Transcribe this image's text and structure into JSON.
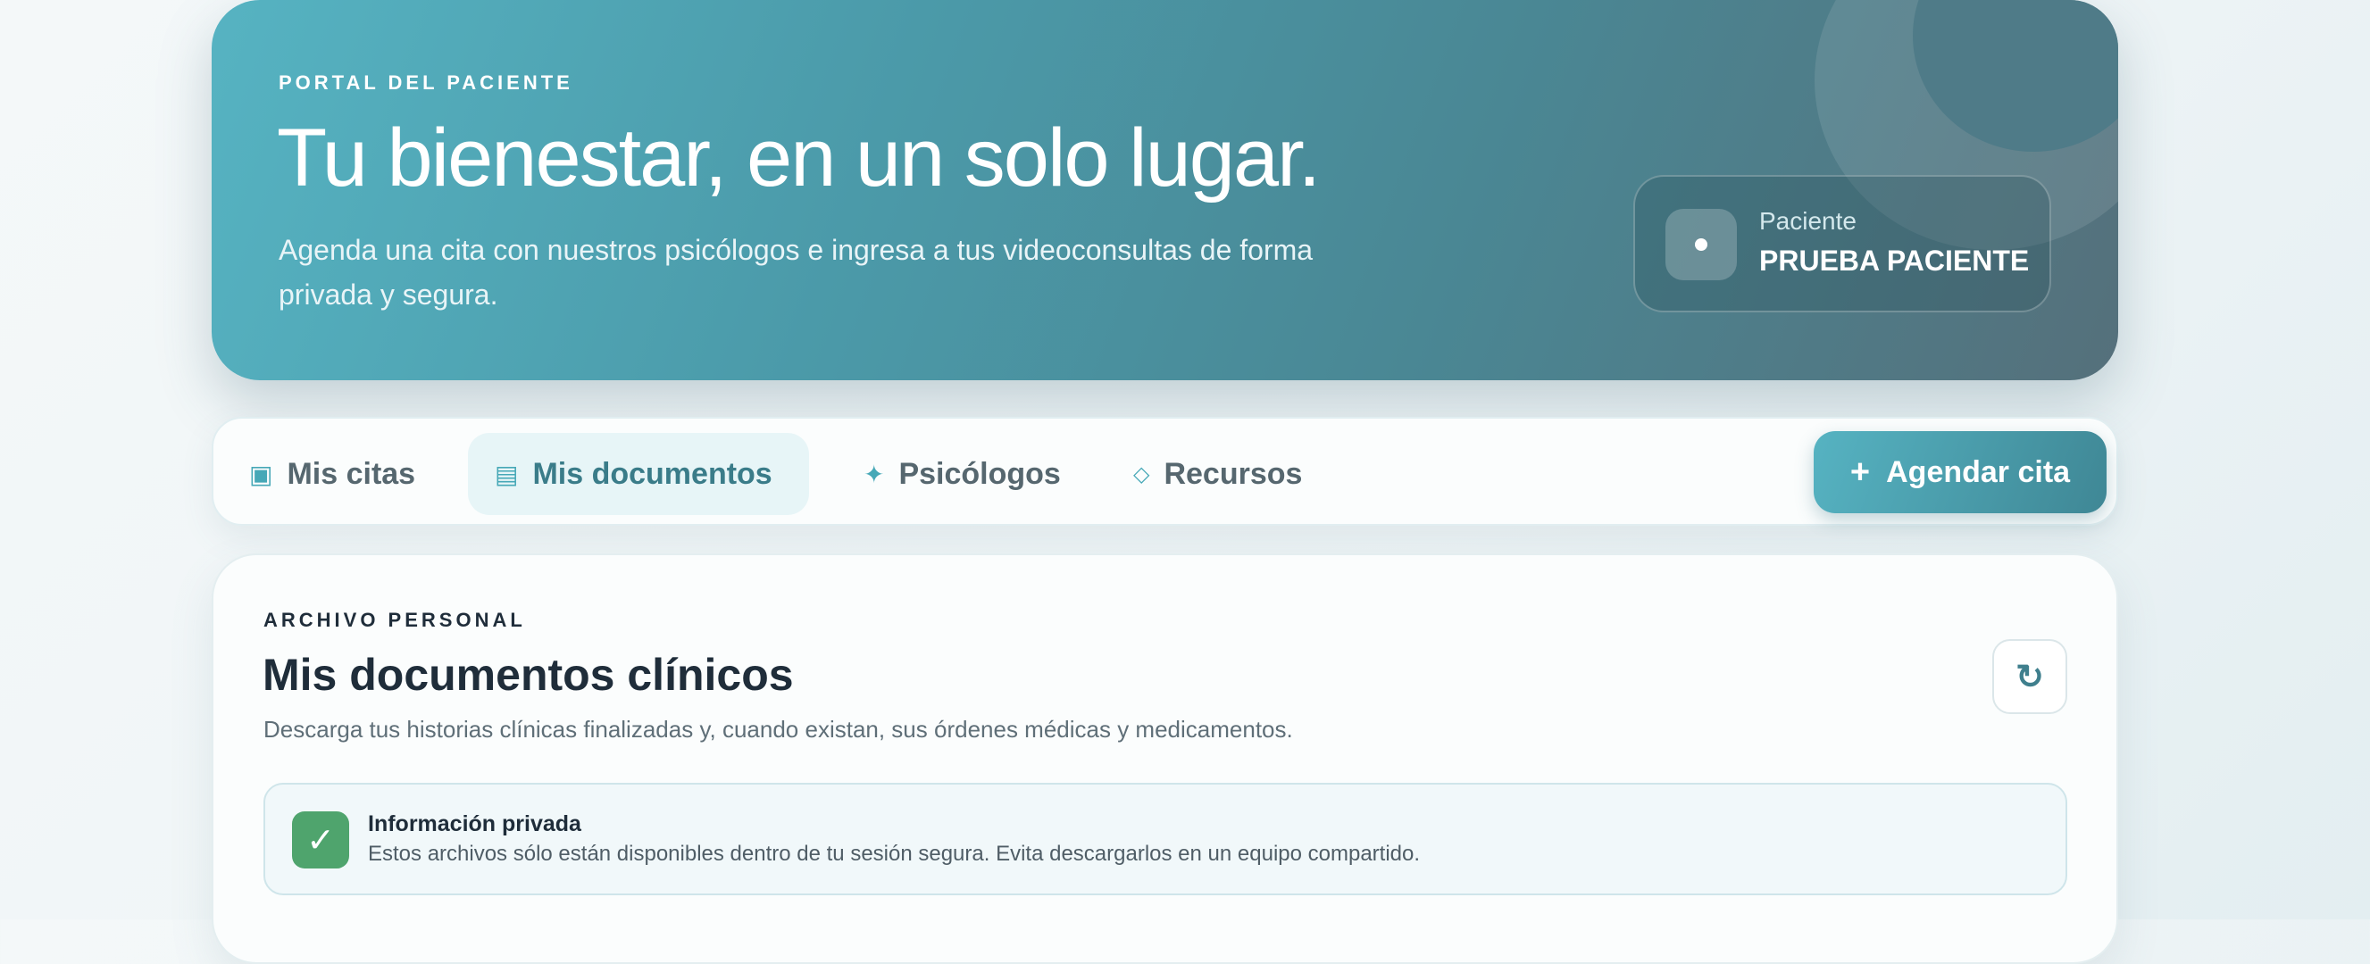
{
  "hero": {
    "eyebrow": "PORTAL DEL PACIENTE",
    "title": "Tu bienestar, en un solo lugar.",
    "subtitle": "Agenda una cita con nuestros psicólogos e ingresa a tus videoconsultas de forma privada y segura.",
    "patient": {
      "role": "Paciente",
      "name": "PRUEBA PACIENTE",
      "icon": "user-dot-icon"
    }
  },
  "tabs": [
    {
      "label": "Mis citas",
      "icon": "▣",
      "icon_name": "calendar-square-icon",
      "active": false
    },
    {
      "label": "Mis documentos",
      "icon": "▤",
      "icon_name": "document-icon",
      "active": true
    },
    {
      "label": "Psicólogos",
      "icon": "✦",
      "icon_name": "sparkle-icon",
      "active": false
    },
    {
      "label": "Recursos",
      "icon": "◇",
      "icon_name": "diamond-icon",
      "active": false
    }
  ],
  "actions": {
    "book_label": "Agendar cita",
    "book_icon": "+"
  },
  "panel": {
    "eyebrow": "ARCHIVO PERSONAL",
    "title": "Mis documentos clínicos",
    "description": "Descarga tus historias clínicas finalizadas y, cuando existan, sus órdenes médicas y medicamentos.",
    "refresh_icon": "↻",
    "notice": {
      "icon": "✓",
      "title": "Información privada",
      "text": "Estos archivos sólo están disponibles dentro de tu sesión segura. Evita descargarlos en un equipo compartido."
    }
  },
  "colors": {
    "brand": "#4b9aa9",
    "brand_light": "#56b3c2",
    "active_tab_bg": "#e7f5f7",
    "success": "#4fa46d"
  }
}
